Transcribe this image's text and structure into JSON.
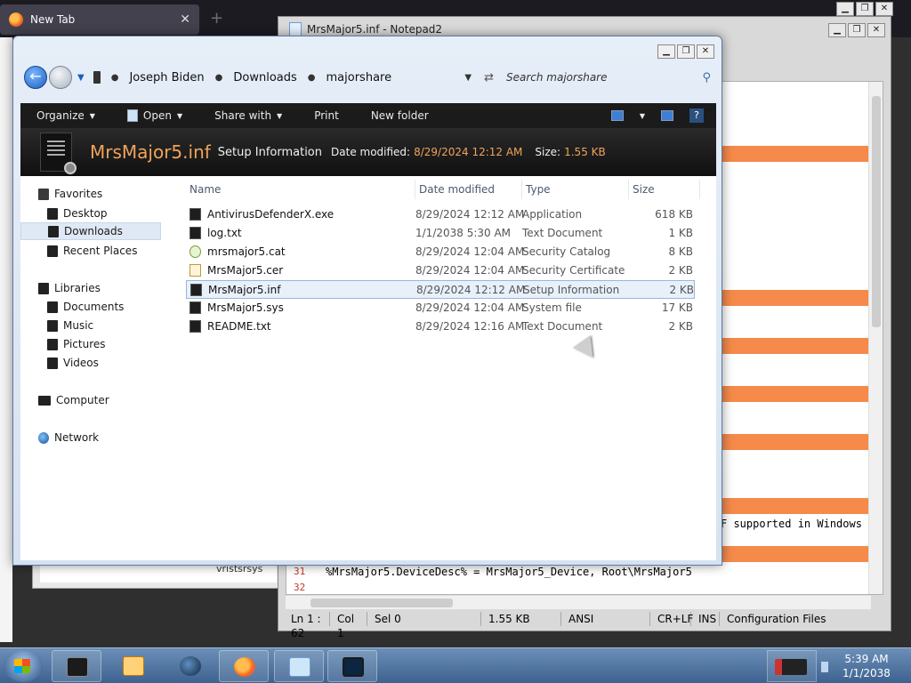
{
  "firefox": {
    "tab_title": "New Tab",
    "close_glyph": "✕",
    "new_tab_glyph": "+"
  },
  "notepad": {
    "title": "MrsMajor5.inf - Notepad2",
    "code_line_partial": "F supported in Windows 1",
    "line_31_no": "31",
    "line_31_text": "%MrsMajor5.DeviceDesc% = MrsMajor5_Device, Root\\MrsMajor5",
    "line_32_no": "32",
    "status": {
      "position": "Ln 1 : 62",
      "col": "Col 1",
      "sel": "Sel 0",
      "size": "1.55 KB",
      "encoding": "ANSI",
      "eol": "CR+LF",
      "mode": "INS",
      "scheme": "Configuration Files"
    },
    "band_color": "#f58a4b"
  },
  "bgwin": {
    "partial_text": "vristsrsys"
  },
  "explorer": {
    "breadcrumbs": [
      "Joseph Biden",
      "Downloads",
      "majorshare"
    ],
    "search_placeholder": "Search majorshare",
    "toolbar": {
      "organize": "Organize",
      "open": "Open",
      "share_with": "Share with",
      "print": "Print",
      "new_folder": "New folder"
    },
    "details": {
      "file_name": "MrsMajor5.inf",
      "file_type": "Setup Information",
      "date_label": "Date modified:",
      "date_value": "8/29/2024 12:12 AM",
      "size_label": "Size:",
      "size_value": "1.55 KB"
    },
    "nav": {
      "favorites": "Favorites",
      "desktop": "Desktop",
      "downloads": "Downloads",
      "recent_places": "Recent Places",
      "libraries": "Libraries",
      "documents": "Documents",
      "music": "Music",
      "pictures": "Pictures",
      "videos": "Videos",
      "computer": "Computer",
      "network": "Network"
    },
    "columns": {
      "name": "Name",
      "date_modified": "Date modified",
      "type": "Type",
      "size": "Size"
    },
    "files": [
      {
        "name": "AntivirusDefenderX.exe",
        "date": "8/29/2024 12:12 AM",
        "type": "Application",
        "size": "618 KB"
      },
      {
        "name": "log.txt",
        "date": "1/1/2038 5:30 AM",
        "type": "Text Document",
        "size": "1 KB"
      },
      {
        "name": "mrsmajor5.cat",
        "date": "8/29/2024 12:04 AM",
        "type": "Security Catalog",
        "size": "8 KB"
      },
      {
        "name": "MrsMajor5.cer",
        "date": "8/29/2024 12:04 AM",
        "type": "Security Certificate",
        "size": "2 KB"
      },
      {
        "name": "MrsMajor5.inf",
        "date": "8/29/2024 12:12 AM",
        "type": "Setup Information",
        "size": "2 KB"
      },
      {
        "name": "MrsMajor5.sys",
        "date": "8/29/2024 12:04 AM",
        "type": "System file",
        "size": "17 KB"
      },
      {
        "name": "README.txt",
        "date": "8/29/2024 12:16 AM",
        "type": "Text Document",
        "size": "2 KB"
      }
    ],
    "accent_color": "#f0a35a"
  },
  "taskbar": {
    "time": "5:39 AM",
    "date": "1/1/2038"
  }
}
